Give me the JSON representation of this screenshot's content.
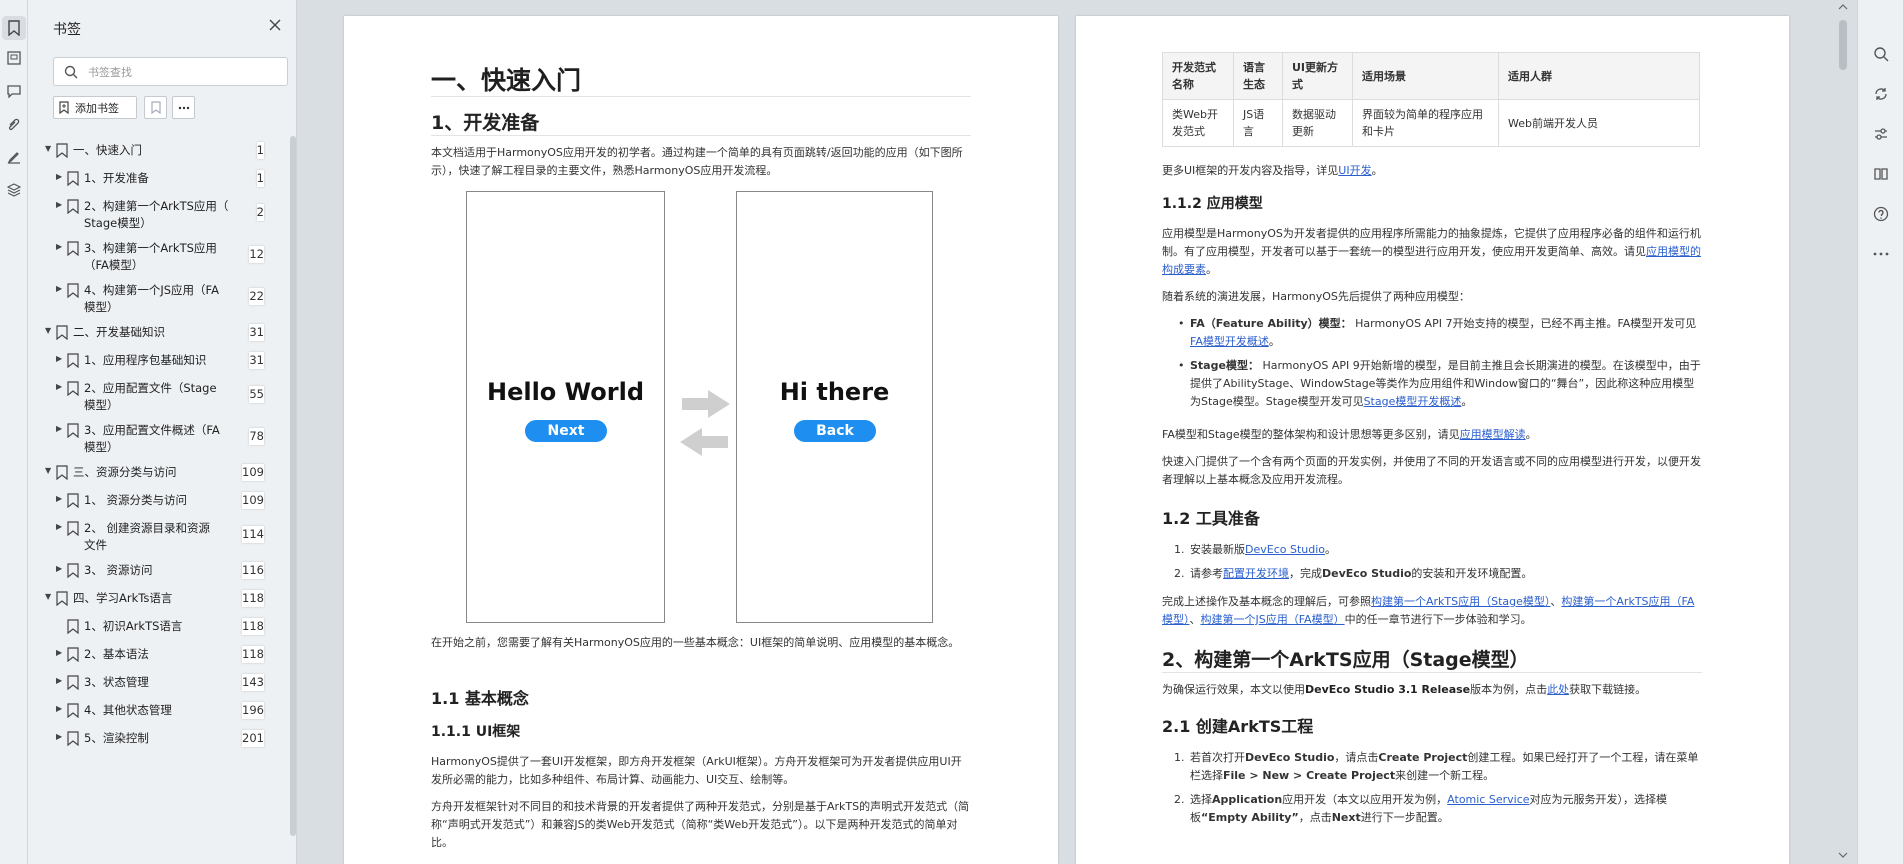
{
  "panel": {
    "title": "书签",
    "search_placeholder": "书签查找",
    "add_bookmark_label": "添加书签"
  },
  "tree": [
    {
      "label": "一、快速入门",
      "page": "1",
      "level": 0,
      "expanded": true
    },
    {
      "label": "1、开发准备",
      "page": "1",
      "level": 1
    },
    {
      "label": "2、构建第一个ArkTS应用（Stage模型）",
      "label_l1": "2、构建第一个ArkTS应用（",
      "label_l2": "Stage模型）",
      "page": "2",
      "level": 1
    },
    {
      "label": "3、构建第一个ArkTS应用（FA模型）",
      "label_l1": "3、构建第一个ArkTS应用",
      "label_l2": "（FA模型）",
      "page": "12",
      "level": 1
    },
    {
      "label": "4、构建第一个JS应用（FA模型）",
      "label_l1": "4、构建第一个JS应用（FA",
      "label_l2": "模型）",
      "page": "22",
      "level": 1
    },
    {
      "label": "二、开发基础知识",
      "page": "31",
      "level": 0,
      "expanded": true
    },
    {
      "label": "1、应用程序包基础知识",
      "page": "31",
      "level": 1
    },
    {
      "label": "2、应用配置文件（Stage模型）",
      "label_l1": "2、应用配置文件（Stage",
      "label_l2": "模型）",
      "page": "55",
      "level": 1
    },
    {
      "label": "3、应用配置文件概述（FA模型）",
      "label_l1": "3、应用配置文件概述（FA",
      "label_l2": "模型）",
      "page": "78",
      "level": 1
    },
    {
      "label": "三、资源分类与访问",
      "page": "109",
      "level": 0,
      "expanded": true
    },
    {
      "label": "1、 资源分类与访问",
      "page": "109",
      "level": 1
    },
    {
      "label": "2、 创建资源目录和资源文件",
      "label_l1": "2、 创建资源目录和资源",
      "label_l2": "文件",
      "page": "114",
      "level": 1
    },
    {
      "label": "3、 资源访问",
      "page": "116",
      "level": 1
    },
    {
      "label": "四、学习ArkTs语言",
      "page": "118",
      "level": 0,
      "expanded": true
    },
    {
      "label": "1、初识ArkTS语言",
      "page": "118",
      "level": 1,
      "leaf": true
    },
    {
      "label": "2、基本语法",
      "page": "118",
      "level": 1
    },
    {
      "label": "3、状态管理",
      "page": "143",
      "level": 1
    },
    {
      "label": "4、其他状态管理",
      "page": "196",
      "level": 1
    },
    {
      "label": "5、渲染控制",
      "page": "201",
      "level": 1
    }
  ],
  "page1": {
    "h1": "一、快速入门",
    "h2_prep": "1、开发准备",
    "intro": "本文档适用于HarmonyOS应用开发的初学者。通过构建一个简单的具有页面跳转/返回功能的应用（如下图所示），快速了解工程目录的主要文件，熟悉HarmonyOS应用开发流程。",
    "phone1_title": "Hello World",
    "phone1_button": "Next",
    "phone2_title": "Hi there",
    "phone2_button": "Back",
    "before_start": "在开始之前，您需要了解有关HarmonyOS应用的一些基本概念：UI框架的简单说明、应用模型的基本概念。",
    "h3_concepts": "1.1 基本概念",
    "h4_ui": "1.1.1 UI框架",
    "ui_p1": "HarmonyOS提供了一套UI开发框架，即方舟开发框架（ArkUI框架）。方舟开发框架可为开发者提供应用UI开发所必需的能力，比如多种组件、布局计算、动画能力、UI交互、绘制等。",
    "ui_p2": "方舟开发框架针对不同目的和技术背景的开发者提供了两种开发范式，分别是基于ArkTS的声明式开发范式（简称“声明式开发范式”）和兼容JS的类Web开发范式（简称“类Web开发范式”）。以下是两种开发范式的简单对比。"
  },
  "page2": {
    "table_headers": [
      "开发范式名称",
      "语言生态",
      "UI更新方式",
      "适用场景",
      "适用人群"
    ],
    "table_row": [
      "类Web开发范式",
      "JS语言",
      "数据驱动更新",
      "界面较为简单的程序应用和卡片",
      "Web前端开发人员"
    ],
    "more_ui_prefix": "更多UI框架的开发内容及指导，详见",
    "more_ui_link": "UI开发",
    "more_ui_suffix": "。",
    "h4_model": "1.1.2 应用模型",
    "model_p1": "应用模型是HarmonyOS为开发者提供的应用程序所需能力的抽象提炼，它提供了应用程序必备的组件和运行机制。有了应用模型，开发者可以基于一套统一的模型进行应用开发，使应用开发更简单、高效。请见",
    "model_p1_link": "应用模型的构成要素",
    "model_p1_suffix": "。",
    "model_p2": "随着系统的演进发展，HarmonyOS先后提供了两种应用模型：",
    "fa_bold": "FA（Feature Ability）模型：",
    "fa_text": " HarmonyOS API 7开始支持的模型，已经不再主推。FA模型开发可见",
    "fa_link": "FA模型开发概述",
    "stage_bold": "Stage模型：",
    "stage_text": " HarmonyOS API 9开始新增的模型，是目前主推且会长期演进的模型。在该模型中，由于提供了AbilityStage、WindowStage等类作为应用组件和Window窗口的“舞台”，因此称这种应用模型为Stage模型。Stage模型开发可见",
    "stage_link": "Stage模型开发概述",
    "diff_prefix": "FA模型和Stage模型的整体架构和设计思想等更多区别，请见",
    "diff_link": "应用模型解读",
    "quick_p": "快速入门提供了一个含有两个页面的开发实例，并使用了不同的开发语言或不同的应用模型进行开发，以便开发者理解以上基本概念及应用开发流程。",
    "h3_tools": "1.2 工具准备",
    "tool1_prefix": "安装最新版",
    "tool1_link": "DevEco Studio",
    "tool2_prefix": "请参考",
    "tool2_link": "配置开发环境",
    "tool2_mid": "，完成",
    "tool2_bold": "DevEco Studio",
    "tool2_suffix": "的安装和开发环境配置。",
    "after_prefix": "完成上述操作及基本概念的理解后，可参照",
    "after_link1": "构建第一个ArkTS应用（Stage模型）",
    "after_link2": "构建第一个ArkTS应用（FA模型）",
    "after_link3": "构建第一个JS应用（FA模型）",
    "after_suffix": "中的任一章节进行下一步体验和学习。",
    "h2_build": "2、构建第一个ArkTS应用（Stage模型）",
    "build_prefix": "为确保运行效果，本文以使用",
    "build_bold": "DevEco Studio 3.1 Release",
    "build_mid": "版本为例，点击",
    "build_link": "此处",
    "build_suffix": "获取下载链接。",
    "h3_create": "2.1 创建ArkTS工程",
    "step1_a": "若首次打开",
    "step1_b": "DevEco Studio",
    "step1_c": "，请点击",
    "step1_d": "Create Project",
    "step1_e": "创建工程。如果已经打开了一个工程，请在菜单栏选择",
    "step1_f": "File > New > Create Project",
    "step1_g": "来创建一个新工程。",
    "step2_a": "选择",
    "step2_b": "Application",
    "step2_c": "应用开发（本文以应用开发为例，",
    "step2_link": "Atomic Service",
    "step2_d": "对应为元服务开发），选择模板",
    "step2_e": "“Empty Ability”",
    "step2_f": "，点击",
    "step2_g": "Next",
    "step2_h": "进行下一步配置。"
  }
}
